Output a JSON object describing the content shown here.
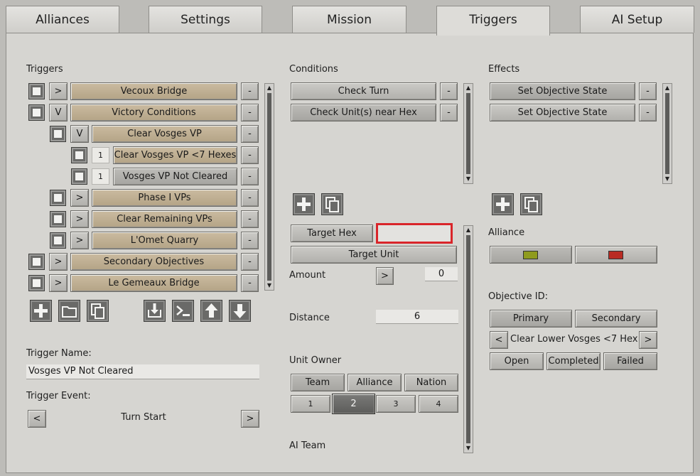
{
  "tabs": [
    "Alliances",
    "Settings",
    "Mission",
    "Triggers",
    "AI Setup"
  ],
  "triggers": {
    "heading": "Triggers",
    "rows": [
      {
        "toggle": ">",
        "label": "Vecoux Bridge",
        "remove": "-"
      },
      {
        "toggle": "V",
        "label": "Victory Conditions",
        "remove": "-"
      },
      {
        "toggle": "V",
        "label": "Clear Vosges VP",
        "remove": "-"
      },
      {
        "toggle": "1",
        "label": "Clear Vosges VP <7 Hexes",
        "remove": "-"
      },
      {
        "toggle": "1",
        "label": "Vosges VP Not Cleared",
        "remove": "-"
      },
      {
        "toggle": ">",
        "label": "Phase I VPs",
        "remove": "-"
      },
      {
        "toggle": ">",
        "label": "Clear Remaining VPs",
        "remove": "-"
      },
      {
        "toggle": ">",
        "label": "L'Omet Quarry",
        "remove": "-"
      },
      {
        "toggle": ">",
        "label": "Secondary Objectives",
        "remove": "-"
      },
      {
        "toggle": ">",
        "label": "Le Gemeaux Bridge",
        "remove": "-"
      }
    ],
    "name_label": "Trigger Name:",
    "name_value": "Vosges VP Not Cleared",
    "event_label": "Trigger Event:",
    "event_value": "Turn Start",
    "event_prev": "<",
    "event_next": ">"
  },
  "conditions": {
    "heading": "Conditions",
    "rows": [
      {
        "label": "Check Turn",
        "remove": "-"
      },
      {
        "label": "Check Unit(s) near Hex",
        "remove": "-"
      }
    ],
    "target_hex": "Target Hex",
    "target_hex_value": "",
    "target_unit": "Target Unit",
    "amount_label": "Amount",
    "amount_toggle": ">",
    "amount_value": "0",
    "distance_label": "Distance",
    "distance_value": "6",
    "unit_owner_label": "Unit Owner",
    "owner_options": [
      "Team",
      "Alliance",
      "Nation"
    ],
    "team_numbers": [
      "1",
      "2",
      "3",
      "4"
    ],
    "ai_team_label": "AI Team"
  },
  "effects": {
    "heading": "Effects",
    "rows": [
      {
        "label": "Set Objective State",
        "remove": "-"
      },
      {
        "label": "Set Objective State",
        "remove": "-"
      }
    ],
    "alliance_label": "Alliance",
    "alliance_colors": [
      "#8f9b1e",
      "#b92b23"
    ],
    "objective_label": "Objective ID:",
    "objective_types": [
      "Primary",
      "Secondary"
    ],
    "objective_prev": "<",
    "objective_next": ">",
    "objective_name": "Clear Lower Vosges <7 Hex",
    "states": [
      "Open",
      "Completed",
      "Failed"
    ]
  },
  "highlight_color": "#d9252a"
}
